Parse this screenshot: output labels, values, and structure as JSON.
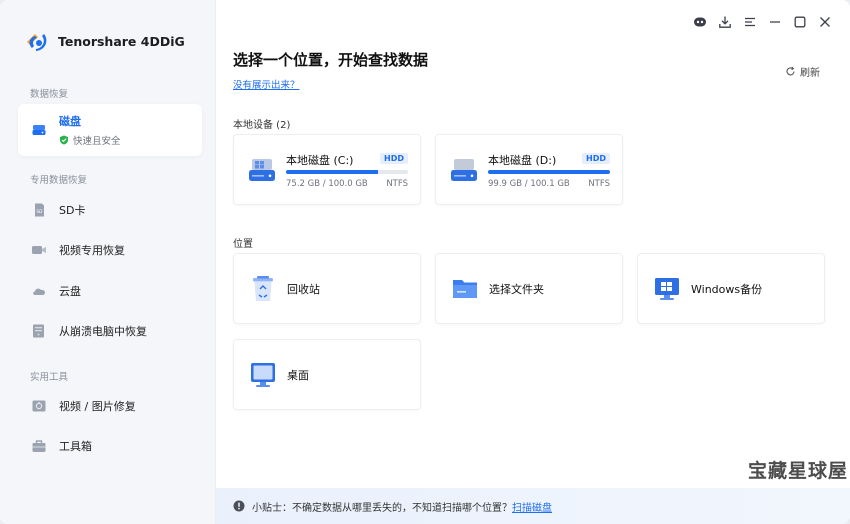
{
  "app": {
    "name": "Tenorshare 4DDiG"
  },
  "sidebar": {
    "sections": [
      {
        "label": "数据恢复"
      },
      {
        "label": "专用数据恢复"
      },
      {
        "label": "实用工具"
      }
    ],
    "active": {
      "label": "磁盘",
      "sub": "快速且安全"
    },
    "items": [
      {
        "label": "SD卡"
      },
      {
        "label": "视频专用恢复"
      },
      {
        "label": "云盘"
      },
      {
        "label": "从崩溃电脑中恢复"
      },
      {
        "label": "视频 / 图片修复"
      },
      {
        "label": "工具箱"
      }
    ]
  },
  "main": {
    "title": "选择一个位置，开始查找数据",
    "help_link": "没有展示出来？",
    "refresh": "刷新",
    "local_devices": "本地设备 (2)",
    "disks": [
      {
        "name": "本地磁盘 (C:)",
        "badge": "HDD",
        "size": "75.2 GB / 100.0 GB",
        "fs": "NTFS",
        "used_pct": 75.2
      },
      {
        "name": "本地磁盘 (D:)",
        "badge": "HDD",
        "size": "99.9 GB / 100.1 GB",
        "fs": "NTFS",
        "used_pct": 99.8
      }
    ],
    "location_label": "位置",
    "locations": [
      {
        "label": "回收站"
      },
      {
        "label": "选择文件夹"
      },
      {
        "label": "Windows备份"
      },
      {
        "label": "桌面"
      }
    ],
    "tip": {
      "text": "小贴士：不确定数据从哪里丢失的，不知道扫描哪个位置？",
      "link": "扫描磁盘"
    }
  },
  "watermark": "宝藏星球屋",
  "colors": {
    "accent": "#1e6ef0",
    "sidebar_bg": "#f4f6f9",
    "safe_green": "#2bb24c"
  }
}
